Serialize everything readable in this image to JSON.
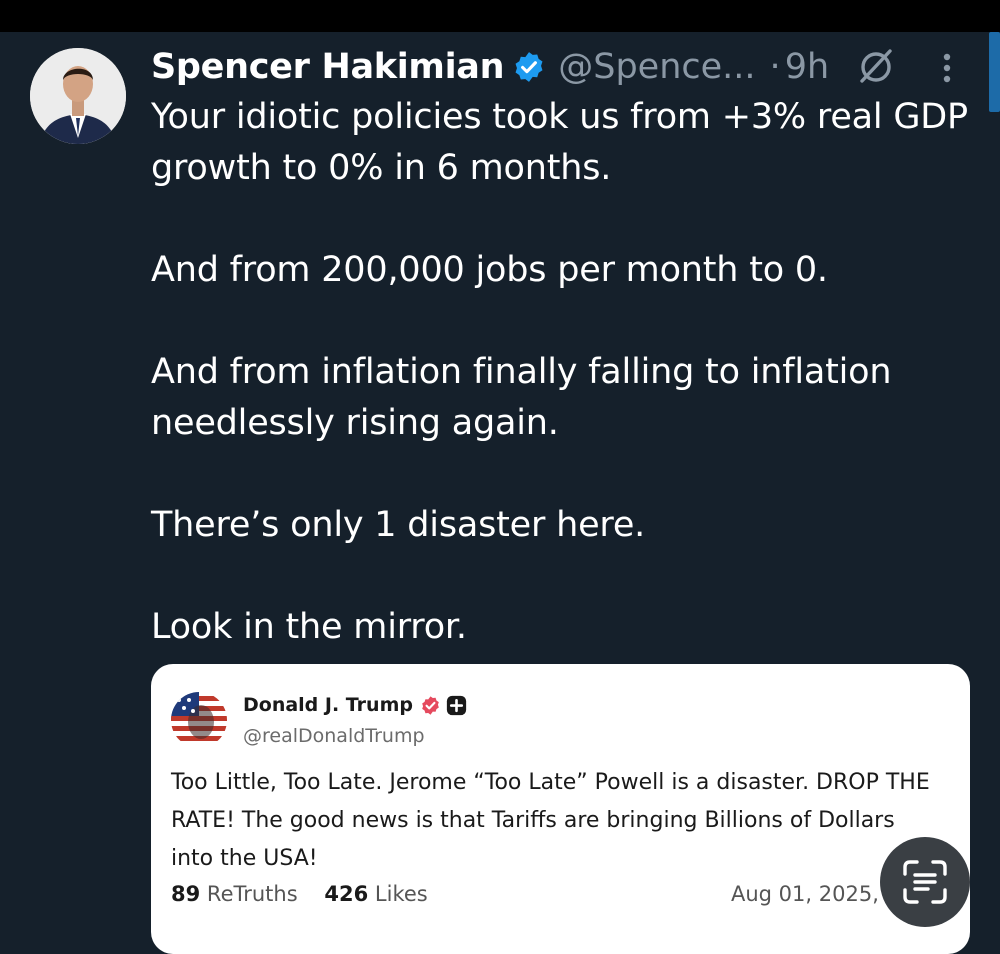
{
  "tweet": {
    "author_name": "Spencer Hakimian",
    "handle": "@Spence...",
    "separator": "·",
    "time": "9h",
    "paragraphs": [
      "Your idiotic policies took us from +3% real GDP growth to 0% in 6 months.",
      "And from 200,000 jobs per month to 0.",
      "And from inflation finally falling to inflation needlessly rising again.",
      "There’s only 1 disaster here.",
      "Look in the mirror."
    ],
    "icons": {
      "verified": "verified-badge-icon",
      "grok": "grok-icon",
      "more": "more-vertical-icon"
    }
  },
  "quoted_post": {
    "author_name": "Donald J. Trump",
    "handle": "@realDonaldTrump",
    "text": "Too Little, Too Late. Jerome “Too Late” Powell is a disaster. DROP THE RATE! The good news is that Tariffs are bringing Billions of Dollars into the USA!",
    "retruths_count": "89",
    "retruths_label": "ReTruths",
    "likes_count": "426",
    "likes_label": "Likes",
    "date": "Aug 01, 2025, 8"
  },
  "colors": {
    "background": "#15202b",
    "text": "#ffffff",
    "secondary_text": "#8b98a5",
    "verified_blue": "#1d9bf0",
    "card_background": "#ffffff",
    "truth_badge": "#e54a5e"
  }
}
